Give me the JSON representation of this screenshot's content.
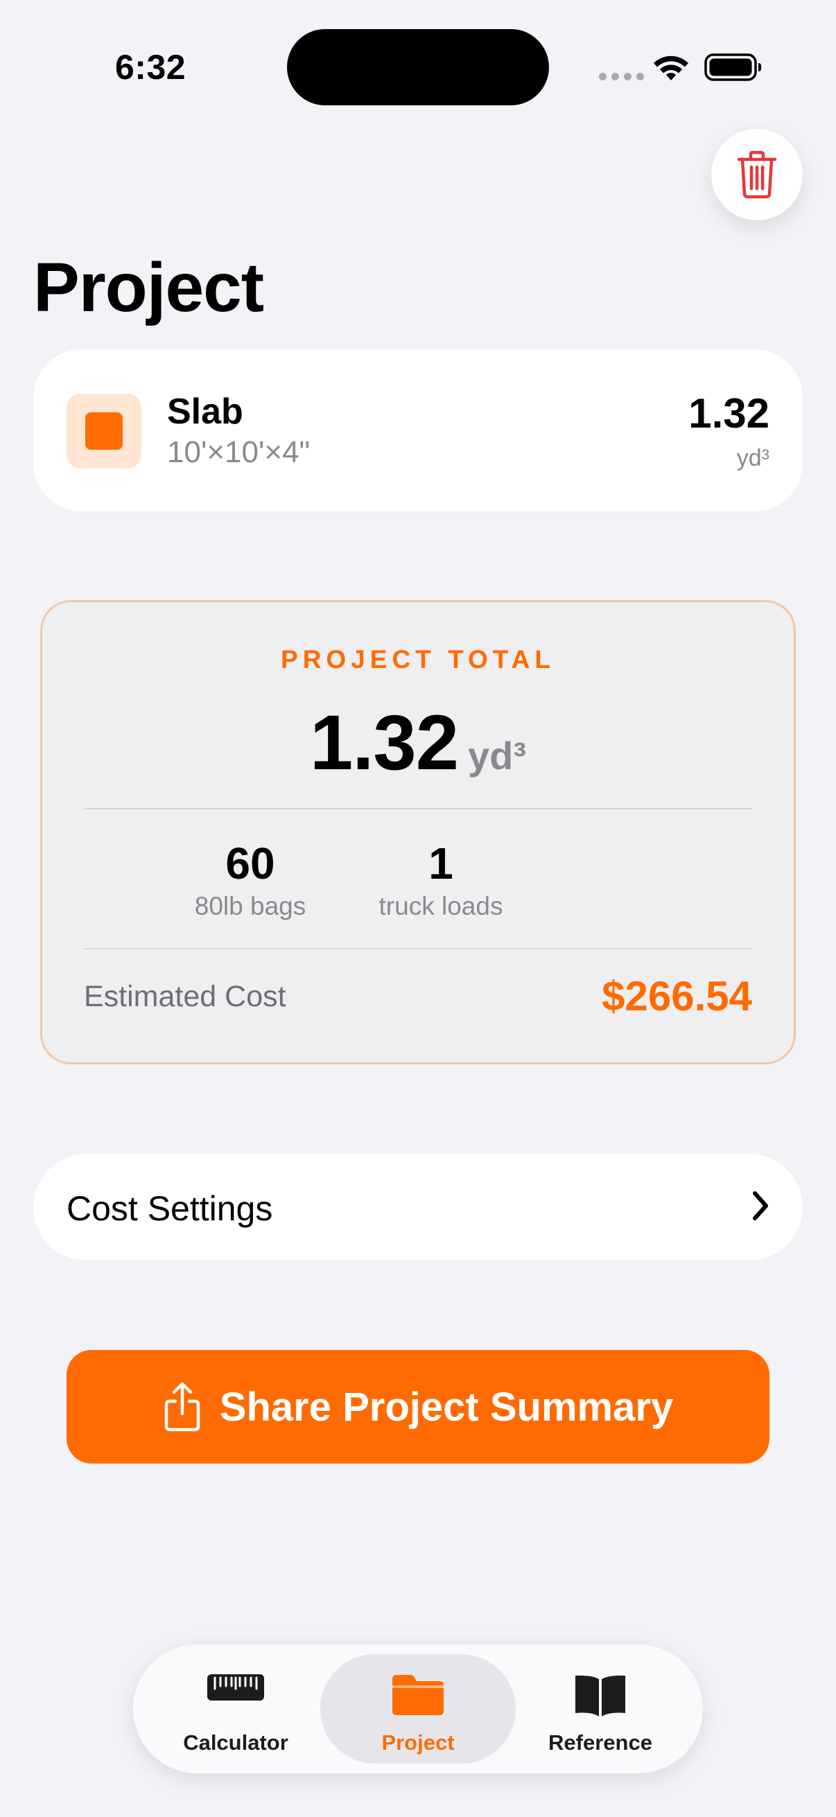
{
  "status_bar": {
    "time": "6:32"
  },
  "header": {
    "title": "Project"
  },
  "item": {
    "name": "Slab",
    "dimensions": "10'×10'×4\"",
    "value": "1.32",
    "unit": "yd³"
  },
  "total": {
    "label": "PROJECT TOTAL",
    "value": "1.32",
    "unit": "yd³",
    "bags_count": "60",
    "bags_label": "80lb bags",
    "trucks_count": "1",
    "trucks_label": "truck loads",
    "cost_label": "Estimated Cost",
    "cost_value": "$266.54"
  },
  "settings": {
    "label": "Cost Settings"
  },
  "share": {
    "label": "Share Project Summary"
  },
  "tabs": [
    {
      "label": "Calculator",
      "icon": "ruler-icon"
    },
    {
      "label": "Project",
      "icon": "folder-icon",
      "selected": true
    },
    {
      "label": "Reference",
      "icon": "book-icon"
    }
  ],
  "colors": {
    "accent": "#FF6B00",
    "danger": "#E5383B",
    "background": "#F2F2F7"
  }
}
